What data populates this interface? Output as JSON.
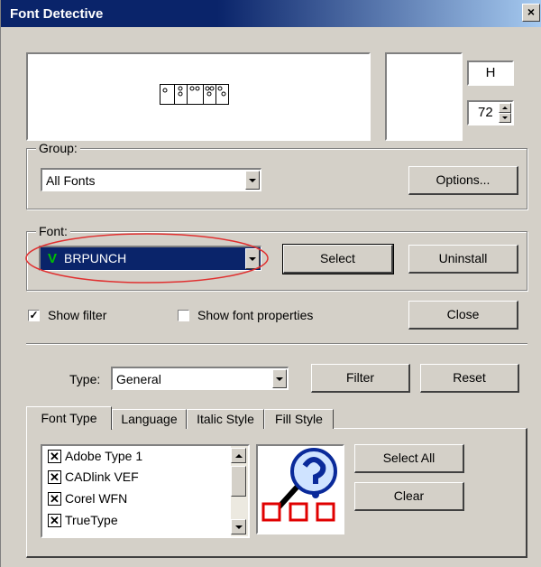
{
  "window": {
    "title": "Font Detective"
  },
  "preview": {
    "char_box": "H",
    "size_value": "72"
  },
  "group": {
    "legend": "Group:",
    "selected": "All Fonts",
    "options_button": "Options..."
  },
  "font": {
    "legend": "Font:",
    "selected": "BRPUNCH",
    "type_marker": "V",
    "select_button": "Select",
    "uninstall_button": "Uninstall"
  },
  "toggles": {
    "show_filter_label": "Show filter",
    "show_filter_checked": true,
    "show_props_label": "Show font properties",
    "show_props_checked": false,
    "close_button": "Close"
  },
  "filter": {
    "type_label": "Type:",
    "type_value": "General",
    "filter_button": "Filter",
    "reset_button": "Reset"
  },
  "tabs": [
    "Font Type",
    "Language",
    "Italic Style",
    "Fill Style"
  ],
  "font_types": [
    {
      "label": "Adobe Type 1",
      "checked": true
    },
    {
      "label": "CADlink VEF",
      "checked": true
    },
    {
      "label": "Corel WFN",
      "checked": true
    },
    {
      "label": "TrueType",
      "checked": true
    }
  ],
  "actions": {
    "select_all": "Select All",
    "clear": "Clear"
  },
  "colors": {
    "highlight": "#0a246a",
    "annotation": "#e03030",
    "marker_green": "#00c000"
  }
}
